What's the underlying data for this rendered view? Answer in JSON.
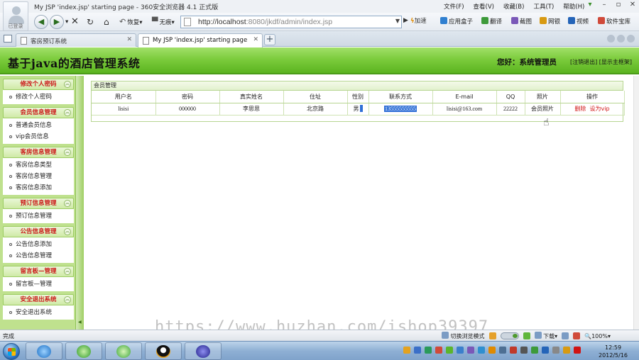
{
  "browser": {
    "window_title": "My JSP 'index.jsp' starting page - 360安全浏览器 4.1 正式版",
    "avatar_label": "已登录",
    "menu": [
      "文件(F)",
      "查看(V)",
      "收藏(B)",
      "工具(T)",
      "帮助(H)"
    ],
    "toolbar": {
      "restore_label": "恢复",
      "no_trace_label": "无痕",
      "address_host": "http://localhost",
      "address_rest": ":8080/jkdf/admin/index.jsp",
      "accelerate_label": "加速",
      "extensions": [
        {
          "label": "应用盒子",
          "color": "#2f7fd0"
        },
        {
          "label": "翻译",
          "color": "#3d9a3a"
        },
        {
          "label": "截图",
          "color": "#7a58b8"
        },
        {
          "label": "网银",
          "color": "#d89a12"
        },
        {
          "label": "视频",
          "color": "#2464b8"
        },
        {
          "label": "软件宝库",
          "color": "#d04a3a"
        }
      ]
    },
    "tabs": [
      {
        "label": "客房预订系统",
        "active": false
      },
      {
        "label": "My JSP 'index.jsp' starting page",
        "active": true
      }
    ],
    "status_text": "完成",
    "status_right": {
      "switch_mode": "切换浏览模式",
      "download": "下载",
      "zoom": "100%"
    }
  },
  "app": {
    "title": "基于java的酒店管理系统",
    "welcome": "您好：系统管理员",
    "logout_link": "[注销退出]",
    "home_link": "[显示主框架]"
  },
  "menu_groups": [
    {
      "title": "修改个人密码",
      "items": [
        "修改个人密码"
      ]
    },
    {
      "title": "会员信息管理",
      "items": [
        "普通会员信息",
        "vip会员信息"
      ]
    },
    {
      "title": "客房信息管理",
      "items": [
        "客房信息类型",
        "客房信息管理",
        "客房信息添加"
      ]
    },
    {
      "title": "预订信息管理",
      "items": [
        "预订信息管理"
      ]
    },
    {
      "title": "公告信息管理",
      "items": [
        "公告信息添加",
        "公告信息管理"
      ]
    },
    {
      "title": "留言板—管理",
      "items": [
        "留言板—管理"
      ]
    },
    {
      "title": "安全退出系统",
      "items": [
        "安全退出系统"
      ]
    }
  ],
  "content": {
    "breadcrumb": "会员管理",
    "columns": [
      "用户名",
      "密码",
      "真实姓名",
      "住址",
      "性别",
      "联系方式",
      "E-mail",
      "QQ",
      "照片",
      "操作"
    ],
    "rows": [
      {
        "username": "lisisi",
        "password": "000000",
        "real_name": "李思思",
        "address": "北京路",
        "gender": "男",
        "phone": "13555555555",
        "email": "lisisi@163.com",
        "qq": "22222",
        "photo_label": "会员照片",
        "delete_label": "删除",
        "vip_label": "设为vip"
      }
    ]
  },
  "watermark": "https://www.huzhan.com/ishop39397",
  "taskbar": {
    "time": "12:59",
    "date": "2012/5/16"
  }
}
